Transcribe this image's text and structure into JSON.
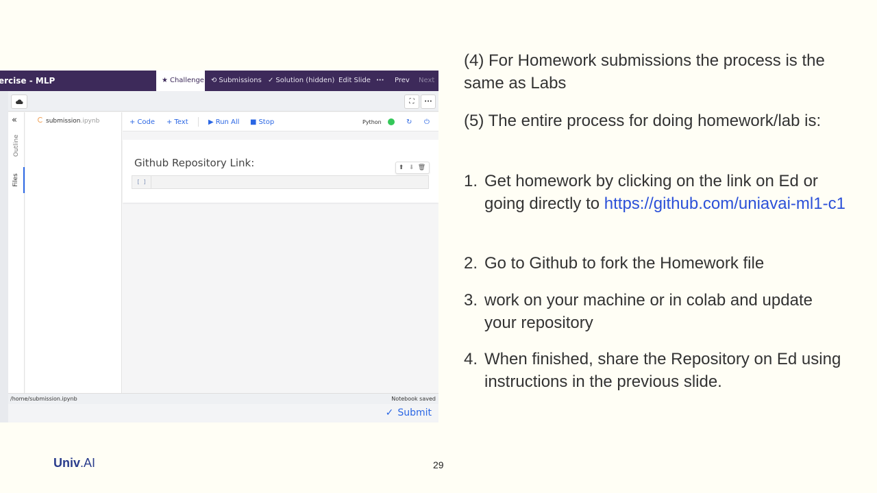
{
  "app": {
    "title": "ercise - MLP",
    "tabs": [
      {
        "label": "Challenge",
        "icon": "star-icon"
      },
      {
        "label": "Submissions",
        "icon": "history-icon"
      },
      {
        "label": "Solution (hidden)",
        "icon": "check-icon"
      },
      {
        "label": "Edit Slide"
      },
      {
        "label": "···",
        "icon": "more-icon"
      },
      {
        "label": "Prev"
      },
      {
        "label": "Next"
      }
    ],
    "rail": {
      "outline": "Outline",
      "files": "Files"
    },
    "file": {
      "name": "submission",
      "ext": ".ipynb"
    },
    "toolbar": {
      "code": "Code",
      "text": "Text",
      "run_all": "Run All",
      "stop": "Stop",
      "kernel": "Python"
    },
    "cell": {
      "markdown": "Github Repository Link:",
      "prompt": "[ ]"
    },
    "status": {
      "path": "/home/submission.ipynb",
      "saved": "Notebook saved"
    },
    "submit": "Submit"
  },
  "slide": {
    "p4": "(4) For Homework submissions the process is the same as Labs",
    "p5": "(5) The entire process for doing homework/lab is:",
    "steps": [
      {
        "num": "1.",
        "text": "Get homework by clicking on the link on Ed or going directly to ",
        "link": "https://github.com/uniavai-ml1-c1"
      },
      {
        "num": "2.",
        "text": "Go to Github to fork the Homework file"
      },
      {
        "num": "3.",
        "text": "work on your machine or in colab and update your repository"
      },
      {
        "num": "4.",
        "text": "When finished, share the Repository on Ed using instructions in the previous slide."
      }
    ],
    "logo_main": "Univ",
    "logo_suffix": ".AI",
    "page_number": "29"
  },
  "colors": {
    "accent": "#2a66e4",
    "topbar": "#3d2a5a",
    "link": "#2b50d8",
    "background": "#fffef5"
  }
}
